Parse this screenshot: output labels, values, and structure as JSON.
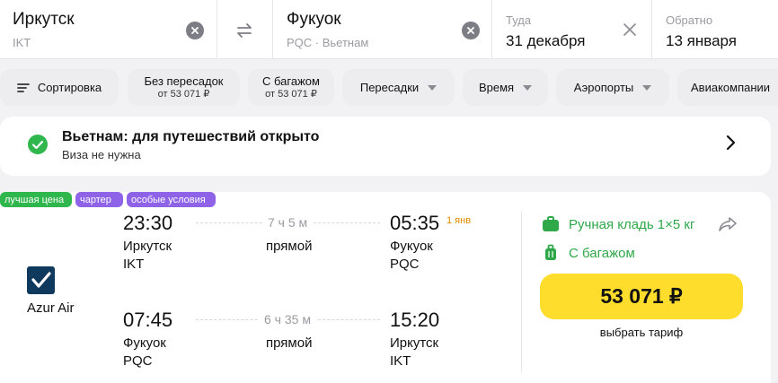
{
  "search": {
    "from_city": "Иркутск",
    "from_code": "IKT",
    "to_city": "Фукуок",
    "to_code": "PQC · Вьетнам",
    "depart_label": "Туда",
    "depart_date": "31 декабря",
    "return_label": "Обратно",
    "return_date": "13 января"
  },
  "filters": {
    "sort": "Сортировка",
    "nonstop_label": "Без пересадок",
    "nonstop_price": "от 53 071 ₽",
    "baggage_label": "С багажом",
    "baggage_price": "от 53 071 ₽",
    "transfers": "Пересадки",
    "time": "Время",
    "airports": "Аэропорты",
    "airlines": "Авиакомпании"
  },
  "visa": {
    "title": "Вьетнам: для путешествий открыто",
    "subtitle": "Виза не нужна"
  },
  "ticket": {
    "badges": [
      "лучшая цена",
      "чартер",
      "особые условия"
    ],
    "airline": "Azur Air",
    "outbound": {
      "dep_time": "23:30",
      "dep_city": "Иркутск",
      "dep_code": "IKT",
      "duration": "7 ч 5 м",
      "stops": "прямой",
      "arr_time": "05:35",
      "arr_note": "1 янв",
      "arr_city": "Фукуок",
      "arr_code": "PQC"
    },
    "inbound": {
      "dep_time": "07:45",
      "dep_city": "Фукуок",
      "dep_code": "PQC",
      "duration": "6 ч 35 м",
      "stops": "прямой",
      "arr_time": "15:20",
      "arr_city": "Иркутск",
      "arr_code": "IKT"
    },
    "hand_luggage": "Ручная кладь 1×5 кг",
    "baggage": "С багажом",
    "price": "53 071 ₽",
    "tariff": "выбрать тариф"
  },
  "colors": {
    "accent_yellow": "#ffdd2d",
    "green": "#2fa84a",
    "purple": "#8e63e8"
  }
}
